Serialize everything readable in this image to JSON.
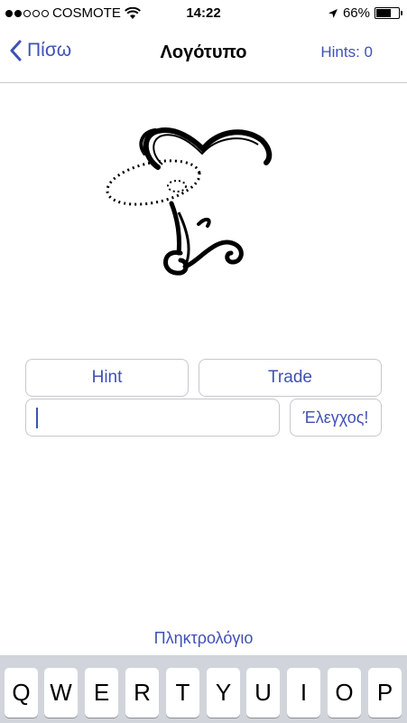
{
  "status": {
    "carrier": "COSMOTE",
    "time": "14:22",
    "battery": "66%",
    "battery_level": 0.66,
    "signal_bars_filled": 2,
    "signal_bars_total": 5
  },
  "nav": {
    "back_label": "Πίσω",
    "title": "Λογότυπο",
    "hints_label": "Hints: 0"
  },
  "actions": {
    "hint_label": "Hint",
    "trade_label": "Trade",
    "check_label": "Έλεγχος!",
    "answer_value": ""
  },
  "keyboard": {
    "toggle_label": "Πληκτρολόγιο",
    "keys": [
      "Q",
      "W",
      "E",
      "R",
      "T",
      "Y",
      "U",
      "I",
      "O",
      "P"
    ]
  },
  "colors": {
    "accent": "#3f51b5",
    "separator": "#c8c7cc",
    "keyboard_bg": "#d1d5db"
  }
}
